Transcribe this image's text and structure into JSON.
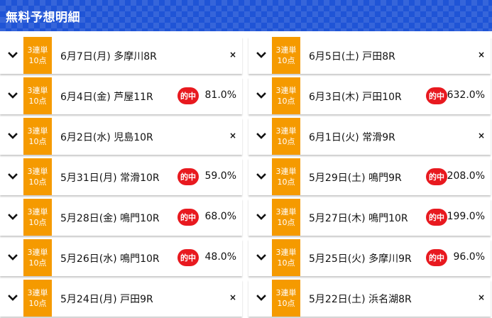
{
  "header": {
    "title": "無料予想明細"
  },
  "tag": {
    "line1": "3連単",
    "line2": "10点"
  },
  "hit_label": "的中",
  "cross_symbol": "×",
  "colors": {
    "header_bg": "#1f54d6",
    "tag_bg": "#f59a00",
    "hit_badge": "#e8191f"
  },
  "races": [
    {
      "date": "6月7日(月)",
      "venue": "多摩川8R",
      "hit": false,
      "rate": ""
    },
    {
      "date": "6月5日(土)",
      "venue": "戸田8R",
      "hit": false,
      "rate": ""
    },
    {
      "date": "6月4日(金)",
      "venue": "芦屋11R",
      "hit": true,
      "rate": "81.0%"
    },
    {
      "date": "6月3日(木)",
      "venue": "戸田10R",
      "hit": true,
      "rate": "632.0%"
    },
    {
      "date": "6月2日(水)",
      "venue": "児島10R",
      "hit": false,
      "rate": ""
    },
    {
      "date": "6月1日(火)",
      "venue": "常滑9R",
      "hit": false,
      "rate": ""
    },
    {
      "date": "5月31日(月)",
      "venue": "常滑10R",
      "hit": true,
      "rate": "59.0%"
    },
    {
      "date": "5月29日(土)",
      "venue": "鳴門9R",
      "hit": true,
      "rate": "208.0%"
    },
    {
      "date": "5月28日(金)",
      "venue": "鳴門10R",
      "hit": true,
      "rate": "68.0%"
    },
    {
      "date": "5月27日(木)",
      "venue": "鳴門10R",
      "hit": true,
      "rate": "199.0%"
    },
    {
      "date": "5月26日(水)",
      "venue": "鳴門10R",
      "hit": true,
      "rate": "48.0%"
    },
    {
      "date": "5月25日(火)",
      "venue": "多摩川9R",
      "hit": true,
      "rate": "96.0%"
    },
    {
      "date": "5月24日(月)",
      "venue": "戸田9R",
      "hit": false,
      "rate": ""
    },
    {
      "date": "5月22日(土)",
      "venue": "浜名湖8R",
      "hit": false,
      "rate": ""
    }
  ]
}
